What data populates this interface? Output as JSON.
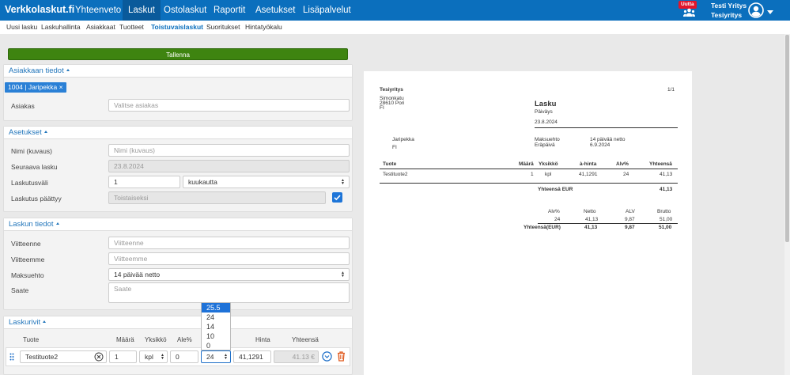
{
  "topnav": {
    "brand": "Verkkolaskut.fi",
    "items": [
      "Yhteenveto",
      "Laskut",
      "Ostolaskut",
      "Raportit",
      "Asetukset",
      "Lisäpalvelut"
    ],
    "badge": "Uutta",
    "company_line1": "Testi Yritys",
    "company_line2": "Tesiyritys"
  },
  "subnav": {
    "items": [
      "Uusi lasku",
      "Laskuhallinta",
      "Asiakkaat",
      "Tuotteet",
      "Toistuvaislaskut",
      "Suoritukset",
      "Hintatyökalu"
    ]
  },
  "save_label": "Tallenna",
  "customer": {
    "title": "Asiakkaan tiedot",
    "chip": "1004 | Jaripekka ×",
    "label": "Asiakas",
    "placeholder": "Valitse asiakas"
  },
  "settings": {
    "title": "Asetukset",
    "name_label": "Nimi (kuvaus)",
    "name_placeholder": "Nimi (kuvaus)",
    "next_label": "Seuraava lasku",
    "next_value": "23.8.2024",
    "interval_label": "Laskutusväli",
    "interval_value": "1",
    "interval_unit": "kuukautta",
    "ends_label": "Laskutus päättyy",
    "ends_value": "Toistaiseksi"
  },
  "invoice_info": {
    "title": "Laskun tiedot",
    "ref_label": "Viitteenne",
    "ref_placeholder": "Viitteenne",
    "our_ref_label": "Viitteemme",
    "our_ref_placeholder": "Viitteemme",
    "terms_label": "Maksuehto",
    "terms_value": "14 päivää netto",
    "note_label": "Saate",
    "note_placeholder": "Saate"
  },
  "rows": {
    "title": "Laskurivit",
    "headers": [
      "Tuote",
      "Määrä",
      "Yksikkö",
      "Ale%",
      "Hinta",
      "Yhteensä"
    ],
    "product": "Testituote2",
    "qty": "1",
    "unit": "kpl",
    "discount": "0",
    "vat": "24",
    "price": "41,1291",
    "total": "41.13 €"
  },
  "vat_dropdown": [
    "25.5",
    "24",
    "14",
    "10",
    "0"
  ],
  "vat_dropdown_selected": 0,
  "document": {
    "company": "Tesiyritys",
    "page": "1/1",
    "street": "Simonkatu",
    "city": "28610 Pori",
    "country": "FI",
    "heading": "Lasku",
    "date_label": "Päiväys",
    "date": "23.8.2024",
    "customer_name": "Jaripekka",
    "customer_country": "FI",
    "terms_label": "Maksuehto",
    "terms_value": "14 päivää netto",
    "due_label": "Eräpäivä",
    "due_value": "6.9.2024",
    "cols": [
      "Tuote",
      "Määrä",
      "Yksikkö",
      "à-hinta",
      "Alv%",
      "Yhteensä"
    ],
    "row": [
      "Testituote2",
      "1",
      "kpl",
      "41,1291",
      "24",
      "41,13"
    ],
    "total_label": "Yhteensä EUR",
    "total_value": "41,13",
    "vat_cols": [
      "Alv%",
      "Netto",
      "ALV",
      "Brutto"
    ],
    "vat_row": [
      "24",
      "41,13",
      "9,87",
      "51,00"
    ],
    "vat_total": [
      "Yhteensä(EUR)",
      "41,13",
      "9,87",
      "51,00"
    ]
  },
  "colors": {
    "topbar": "#0b6fbd",
    "save": "#3e8410",
    "link": "#2276bb",
    "delete": "#e05a1e"
  }
}
